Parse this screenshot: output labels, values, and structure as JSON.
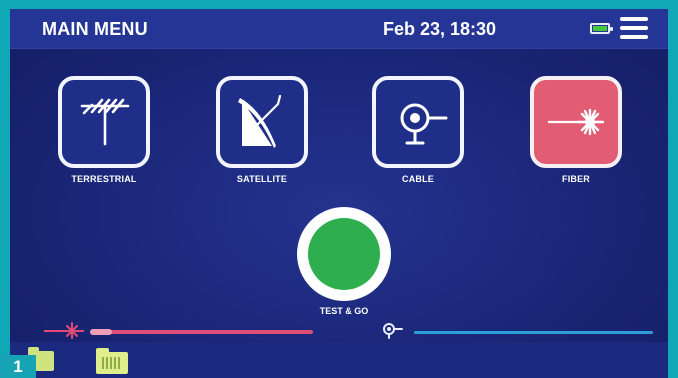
{
  "header": {
    "title": "MAIN MENU",
    "datetime": "Feb 23, 18:30",
    "battery_icon": "battery-icon",
    "menu_icon": "hamburger-menu-icon"
  },
  "tiles": [
    {
      "label": "TERRESTRIAL",
      "icon": "antenna-icon"
    },
    {
      "label": "SATELLITE",
      "icon": "satellite-dish-icon"
    },
    {
      "label": "CABLE",
      "icon": "coax-cable-icon"
    },
    {
      "label": "FIBER",
      "icon": "laser-icon"
    }
  ],
  "test_go": {
    "label": "TEST & GO"
  },
  "signals": {
    "fiber_icon": "laser-icon",
    "cable_icon": "coax-cable-icon"
  },
  "taskbar": {
    "folder_icon": "folder-icon",
    "folder_grid_icon": "folder-grid-icon"
  },
  "badge": "1",
  "colors": {
    "accent": "#10a7b6",
    "screen_bg": "#1a2677",
    "fiber_tile": "#e25c73",
    "test_go": "#2fae4f",
    "fiber_bar": "#de4e78",
    "cable_bar": "#2f9ed8",
    "battery": "#45c93b"
  }
}
